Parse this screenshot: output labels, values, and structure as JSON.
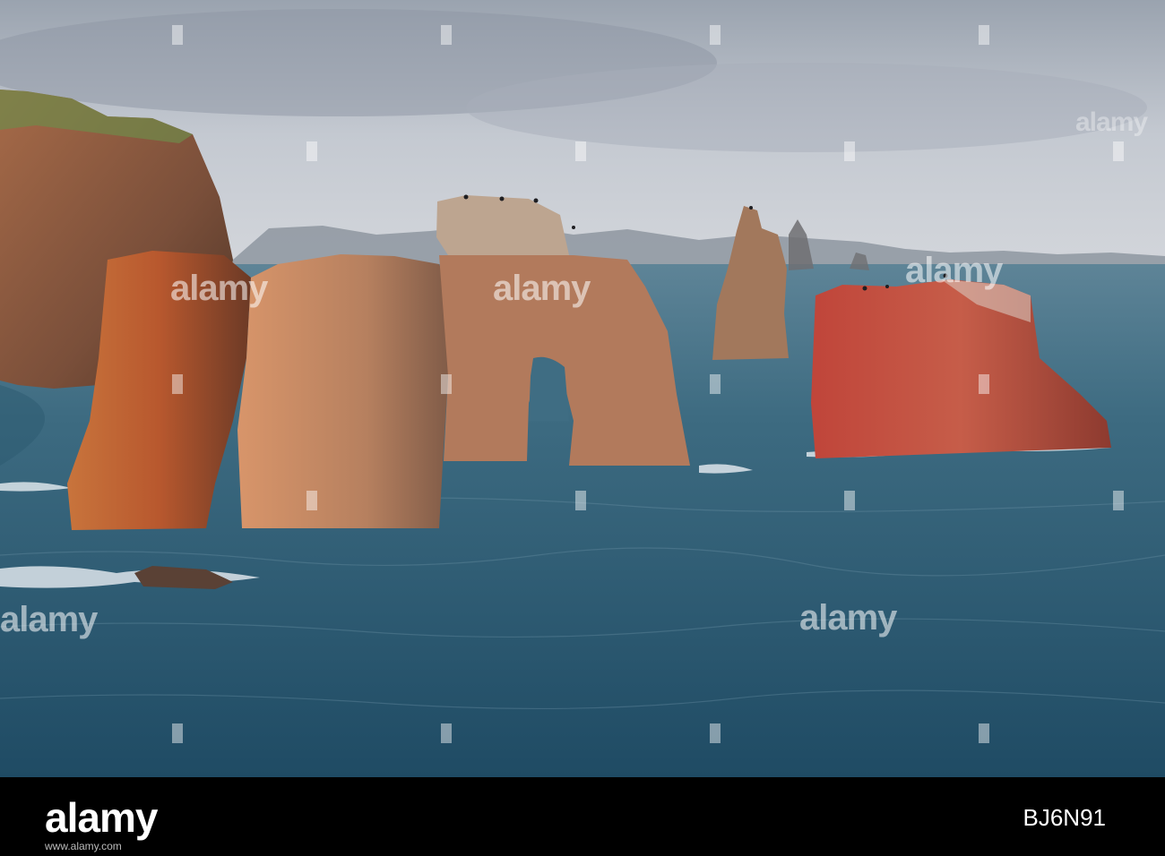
{
  "scene": {
    "subject": "sea stacks and rock arch off a coastal headland",
    "icons": [
      "cliff-headland",
      "rock-arch",
      "sea-stack",
      "seabird"
    ]
  },
  "watermark": {
    "text": "alamy"
  },
  "footer": {
    "brand": "alamy",
    "image_id": "BJ6N91",
    "url": "www.alamy.com"
  },
  "colors": {
    "sky": "#b9bfc8",
    "sea": "#3b6a80",
    "rock": "#b4573a",
    "footer": "#000000"
  }
}
